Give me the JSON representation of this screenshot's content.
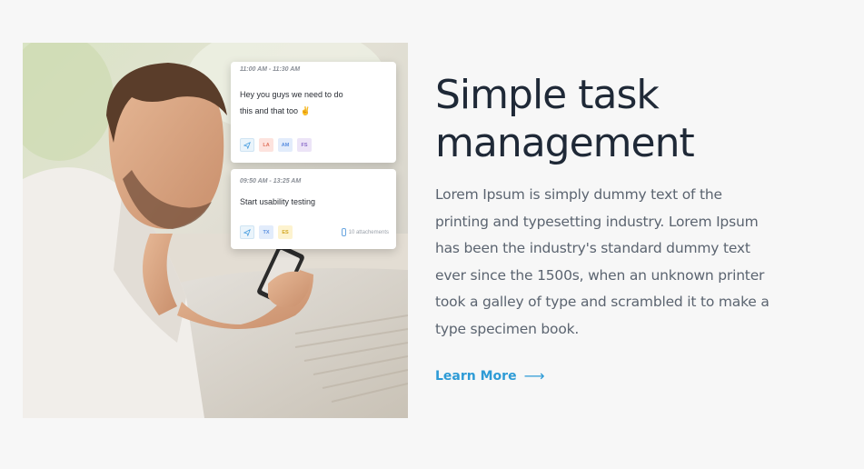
{
  "hero": {
    "title_line1": "Simple task",
    "title_line2": "management",
    "description": "Lorem Ipsum is simply dummy text of the printing and typesetting industry. Lorem Ipsum has been the industry's standard dummy text ever since the 1500s, when an unknown printer took a galley of type and scrambled it to make a type specimen book.",
    "cta_label": "Learn More",
    "cta_arrow": "⟶",
    "cta_color": "#2e9bd6"
  },
  "cards": [
    {
      "time": "11:00 AM - 11:30 AM",
      "line1": "Hey you guys we need to do",
      "line2": "this and that too ✌",
      "tags": [
        {
          "icon": "send-icon"
        },
        {
          "label": "LA",
          "bg": "#fde3de",
          "fg": "#e0735e"
        },
        {
          "label": "AM",
          "bg": "#e2ecfb",
          "fg": "#5b8fe0"
        },
        {
          "label": "FS",
          "bg": "#ece4f7",
          "fg": "#8a6cc9"
        }
      ]
    },
    {
      "time": "09:50 AM - 13:25 AM",
      "line1": "Start usability testing",
      "tags": [
        {
          "icon": "send-icon"
        },
        {
          "label": "TX",
          "bg": "#e2ecfb",
          "fg": "#5b8fe0"
        },
        {
          "label": "ES",
          "bg": "#fdf3cf",
          "fg": "#d2a623"
        }
      ],
      "attachments": "10 attachements"
    }
  ]
}
